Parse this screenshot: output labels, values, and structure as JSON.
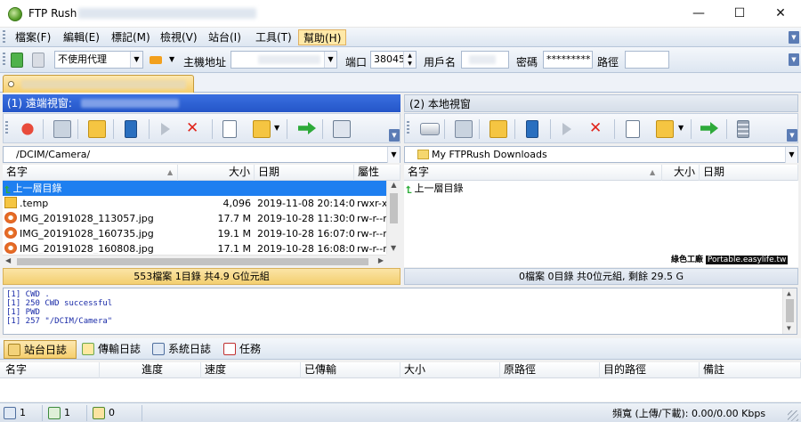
{
  "window": {
    "app_title": "FTP Rush",
    "minimize": "—",
    "maximize": "☐",
    "close": "✕"
  },
  "menu": [
    "檔案(F)",
    "編輯(E)",
    "標記(M)",
    "檢視(V)",
    "站台(I)",
    "工具(T)",
    "幫助(H)"
  ],
  "connection": {
    "proxy": "不使用代理",
    "host_label": "主機地址",
    "port_label": "端口",
    "port": "38045",
    "user_label": "用戶名",
    "password_label": "密碼",
    "password": "*********",
    "path_label": "路徑"
  },
  "remote": {
    "header": "(1) 遠端視窗:",
    "path": "/DCIM/Camera/",
    "columns": [
      "名字",
      "大小",
      "日期",
      "屬性"
    ],
    "parent_label": "上一層目錄",
    "files": [
      {
        "name": ".temp",
        "size": "4,096",
        "date": "2019-11-08 20:14:00",
        "attr": "rwxr-xr",
        "type": "folder"
      },
      {
        "name": "IMG_20191028_113057.jpg",
        "size": "17.7 M",
        "date": "2019-10-28 11:30:00",
        "attr": "rw-r--r",
        "type": "jpg"
      },
      {
        "name": "IMG_20191028_160735.jpg",
        "size": "19.1 M",
        "date": "2019-10-28 16:07:00",
        "attr": "rw-r--r",
        "type": "jpg"
      },
      {
        "name": "IMG_20191028_160808.jpg",
        "size": "17.1 M",
        "date": "2019-10-28 16:08:00",
        "attr": "rw-r--r",
        "type": "jpg"
      }
    ],
    "status": "553檔案 1目錄 共4.9 G位元組"
  },
  "local": {
    "header": "(2) 本地視窗",
    "path": "My FTPRush Downloads",
    "columns": [
      "名字",
      "大小",
      "日期"
    ],
    "parent_label": "上一層目錄",
    "status": "0檔案 0目錄 共0位元組, 剩餘 29.5 G"
  },
  "watermark": "綠色工廠",
  "watermark_url": "Portable.easylife.tw",
  "log": [
    "[1] CWD .",
    "[1] 250 CWD successful",
    "[1] PWD",
    "[1] 257 \"/DCIM/Camera\""
  ],
  "log_tabs": [
    "站台日誌",
    "傳輸日誌",
    "系統日誌",
    "任務"
  ],
  "queue_columns": [
    "名字",
    "進度",
    "速度",
    "已傳輸",
    "大小",
    "原路徑",
    "目的路徑",
    "備註"
  ],
  "statusbar": {
    "count1": "1",
    "count2": "1",
    "count3": "0",
    "bandwidth": "頻寬 (上傳/下載): 0.00/0.00 Kbps"
  },
  "colors": {
    "accent": "#2c5fd4",
    "selection": "#1e7ff0",
    "status_orange": "#f3cf70"
  }
}
